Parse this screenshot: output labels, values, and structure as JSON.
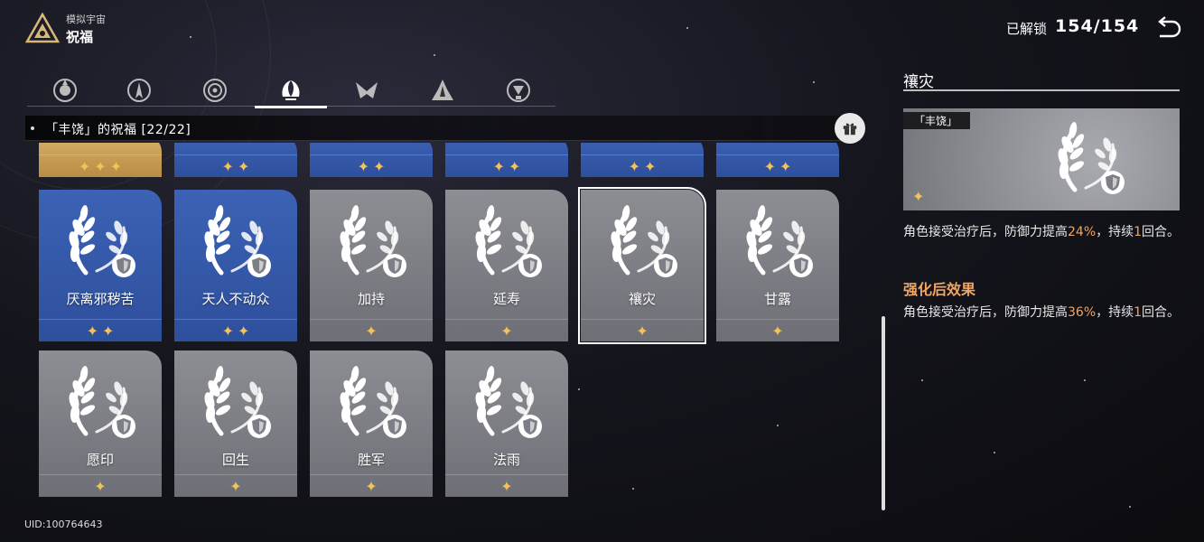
{
  "header": {
    "subtitle": "模拟宇宙",
    "title": "祝福",
    "unlock_label": "已解锁",
    "unlock_count": "154/154"
  },
  "tabs": [
    {
      "icon": "preservation-path-icon",
      "active": false
    },
    {
      "icon": "remembrance-path-icon",
      "active": false
    },
    {
      "icon": "nihility-path-icon",
      "active": false
    },
    {
      "icon": "abundance-path-icon",
      "active": true
    },
    {
      "icon": "hunt-path-icon",
      "active": false
    },
    {
      "icon": "destruction-path-icon",
      "active": false
    },
    {
      "icon": "elation-path-icon",
      "active": false
    }
  ],
  "pathbar": {
    "text": "「丰饶」的祝福 [22/22]"
  },
  "cards": {
    "row0": [
      {
        "name": "",
        "rarity": 3,
        "color": "gold"
      },
      {
        "name": "",
        "rarity": 2,
        "color": "blue"
      },
      {
        "name": "",
        "rarity": 2,
        "color": "blue"
      },
      {
        "name": "",
        "rarity": 2,
        "color": "blue"
      },
      {
        "name": "",
        "rarity": 2,
        "color": "blue"
      },
      {
        "name": "",
        "rarity": 2,
        "color": "blue"
      }
    ],
    "row1": [
      {
        "name": "厌离邪秽苦",
        "rarity": 2,
        "color": "blue",
        "badge": "sword-icon"
      },
      {
        "name": "天人不动众",
        "rarity": 2,
        "color": "blue",
        "badge": "star-burst-icon"
      },
      {
        "name": "加持",
        "rarity": 1,
        "color": "gray",
        "badge": "arrow-up-icon"
      },
      {
        "name": "延寿",
        "rarity": 1,
        "color": "gray",
        "badge": "shield-icon"
      },
      {
        "name": "禳灾",
        "rarity": 1,
        "color": "gray",
        "badge": "shield-icon",
        "selected": true
      },
      {
        "name": "甘露",
        "rarity": 1,
        "color": "gray",
        "badge": "shield-icon"
      }
    ],
    "row2": [
      {
        "name": "愿印",
        "rarity": 1,
        "color": "gray",
        "badge": "shield-icon"
      },
      {
        "name": "回生",
        "rarity": 1,
        "color": "gray",
        "badge": "shield-icon"
      },
      {
        "name": "胜军",
        "rarity": 1,
        "color": "gray",
        "badge": "arrow-up-icon"
      },
      {
        "name": "法雨",
        "rarity": 1,
        "color": "gray",
        "badge": "shield-icon"
      }
    ]
  },
  "uid": "UID:100764643",
  "detail": {
    "title": "禳灾",
    "path_tag": "「丰饶」",
    "rarity": 1,
    "desc_before": "角色接受治疗后，防御力提高",
    "desc_value": "24%",
    "desc_mid": "，持续",
    "desc_turns": "1",
    "desc_after": "回合。",
    "enhanced_title": "强化后效果",
    "enh_before": "角色接受治疗后，防御力提高",
    "enh_value": "36%",
    "enh_mid": "，持续",
    "enh_turns": "1",
    "enh_after": "回合。"
  },
  "colors": {
    "accent": "#f0a661",
    "star": "#f2c35a",
    "card_gray": "#7e7f86",
    "card_blue": "#3558a8",
    "card_gold": "#c89d55"
  }
}
